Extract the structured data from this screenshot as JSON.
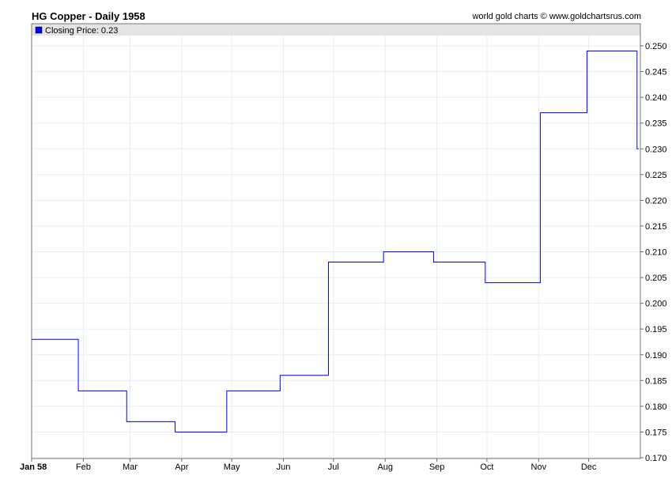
{
  "chart_data": {
    "type": "line",
    "title": "HG Copper - Daily 1958",
    "credit": "world gold charts © www.goldchartsrus.com",
    "legend": {
      "label": "Closing Price: 0.23",
      "color": "#0000ff",
      "placement": "top-left"
    },
    "xlabel": "",
    "ylabel": "",
    "ylim": [
      0.17,
      0.25
    ],
    "yticks": [
      "0.170",
      "0.175",
      "0.180",
      "0.185",
      "0.190",
      "0.195",
      "0.200",
      "0.205",
      "0.210",
      "0.215",
      "0.220",
      "0.225",
      "0.230",
      "0.235",
      "0.240",
      "0.245",
      "0.250"
    ],
    "xticks": [
      {
        "label": "Jan 58",
        "day": 0
      },
      {
        "label": "Feb",
        "day": 31
      },
      {
        "label": "Mar",
        "day": 59
      },
      {
        "label": "Apr",
        "day": 90
      },
      {
        "label": "May",
        "day": 120
      },
      {
        "label": "Jun",
        "day": 151
      },
      {
        "label": "Jul",
        "day": 181
      },
      {
        "label": "Aug",
        "day": 212
      },
      {
        "label": "Sep",
        "day": 243
      },
      {
        "label": "Oct",
        "day": 273
      },
      {
        "label": "Nov",
        "day": 304
      },
      {
        "label": "Dec",
        "day": 334
      }
    ],
    "xlim_days": [
      0,
      365
    ],
    "grid": true,
    "series": [
      {
        "name": "Closing Price",
        "color": "#0000ff",
        "step_points": [
          {
            "day": 0,
            "value": 0.193
          },
          {
            "day": 28,
            "value": 0.183
          },
          {
            "day": 57,
            "value": 0.177
          },
          {
            "day": 86,
            "value": 0.175
          },
          {
            "day": 117,
            "value": 0.183
          },
          {
            "day": 149,
            "value": 0.186
          },
          {
            "day": 178,
            "value": 0.208
          },
          {
            "day": 211,
            "value": 0.21
          },
          {
            "day": 241,
            "value": 0.208
          },
          {
            "day": 272,
            "value": 0.204
          },
          {
            "day": 305,
            "value": 0.237
          },
          {
            "day": 333,
            "value": 0.249
          },
          {
            "day": 363,
            "value": 0.23
          }
        ]
      }
    ]
  }
}
